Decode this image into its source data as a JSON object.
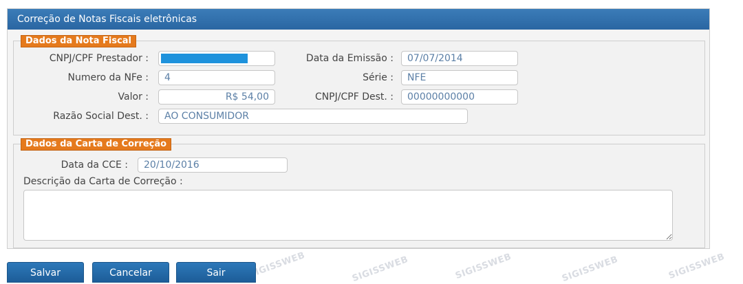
{
  "panel": {
    "title": "Correção de Notas Fiscais eletrônicas"
  },
  "nota_fiscal": {
    "legend": "Dados da Nota Fiscal",
    "cnpj_prestador_label": "CNPJ/CPF Prestador :",
    "data_emissao_label": "Data da Emissão :",
    "data_emissao_value": "07/07/2014",
    "numero_nfe_label": "Numero da NFe :",
    "numero_nfe_value": "4",
    "serie_label": "Série :",
    "serie_value": "NFE",
    "valor_label": "Valor :",
    "valor_value": "R$ 54,00",
    "cnpj_dest_label": "CNPJ/CPF Dest. :",
    "cnpj_dest_value": "00000000000",
    "razao_social_label": "Razão Social Dest. :",
    "razao_social_value": "AO CONSUMIDOR"
  },
  "carta_correcao": {
    "legend": "Dados da Carta de Correção",
    "data_cce_label": "Data da CCE :",
    "data_cce_value": "20/10/2016",
    "descricao_label": "Descrição da Carta de Correção :",
    "descricao_value": ""
  },
  "buttons": {
    "salvar": "Salvar",
    "cancelar": "Cancelar",
    "sair": "Sair"
  },
  "watermark": "SIGISSWEB",
  "colors": {
    "header": "#2f71ad",
    "legend": "#e57a1d",
    "button": "#2468a8",
    "input_text": "#5b7fa6"
  }
}
